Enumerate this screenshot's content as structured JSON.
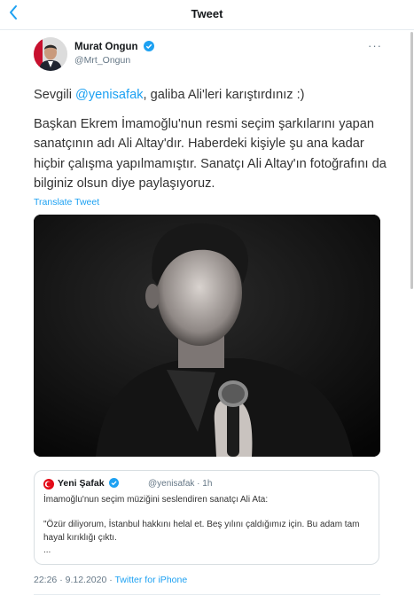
{
  "header": {
    "title": "Tweet",
    "back_icon": "chevron-left-icon"
  },
  "author": {
    "name": "Murat Ongun",
    "handle": "@Mrt_Ongun",
    "verified": true,
    "more_icon": "more-icon"
  },
  "tweet": {
    "greeting_prefix": "Sevgili ",
    "mention": "@yenisafak",
    "greeting_suffix": ", galiba Ali'leri karıştırdınız :)",
    "body": "Başkan Ekrem İmamoğlu'nun resmi seçim şarkılarını yapan sanatçının adı Ali Altay'dır. Haberdeki kişiyle şu ana kadar hiçbir çalışma yapılmamıştır. Sanatçı Ali Altay'ın fotoğrafını da bilginiz olsun diye paylaşıyoruz.",
    "translate_label": "Translate Tweet"
  },
  "quoted": {
    "name": "Yeni Şafak",
    "verified": true,
    "handle_time": "@yenisafak · 1h",
    "line1": "İmamoğlu'nun seçim müziğini seslendiren sanatçı Ali Ata:",
    "line2": "\"Özür diliyorum, İstanbul hakkını helal et. Beş yılını çaldığımız için. Bu adam tam hayal kırıklığı çıktı.",
    "ellipsis": "..."
  },
  "meta": {
    "timestamp": "22:26 · 9.12.2020 · ",
    "source": "Twitter for iPhone"
  },
  "colors": {
    "accent": "#1da1f2",
    "muted": "#657786",
    "divider": "#e6ecf0"
  }
}
